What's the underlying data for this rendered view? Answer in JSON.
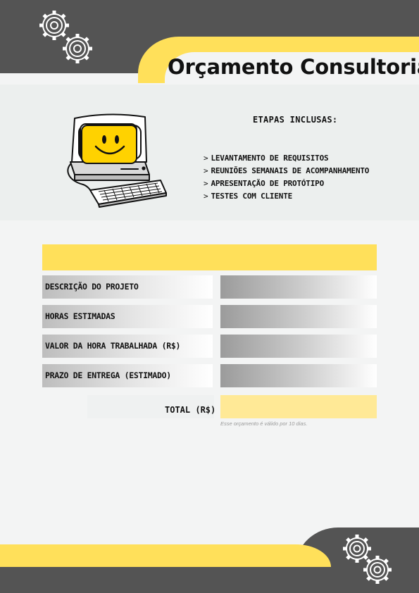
{
  "header": {
    "title": "Orçamento Consultoria"
  },
  "steps": {
    "title": "ETAPAS INCLUSAS:",
    "prefix": ">",
    "items": [
      "LEVANTAMENTO DE REQUISITOS",
      "REUNIÕES SEMANAIS DE ACOMPANHAMENTO",
      "APRESENTAÇÃO DE PROTÓTIPO",
      "TESTES COM CLIENTE"
    ]
  },
  "form": {
    "rows": [
      {
        "label": "DESCRIÇÃO DO PROJETO",
        "value": ""
      },
      {
        "label": "HORAS ESTIMADAS",
        "value": ""
      },
      {
        "label": "VALOR DA HORA TRABALHADA (R$)",
        "value": ""
      },
      {
        "label": "PRAZO DE ENTREGA (ESTIMADO)",
        "value": ""
      }
    ],
    "total_label": "TOTAL (R$)",
    "total_value": "",
    "validity_note": "Esse orçamento é válido por 10 dias."
  },
  "colors": {
    "accent_yellow": "#ffe05a",
    "dark_gray": "#545454",
    "background": "#f3f4f4"
  },
  "icons": [
    "gears-icon",
    "computer-icon",
    "smiley-icon"
  ]
}
